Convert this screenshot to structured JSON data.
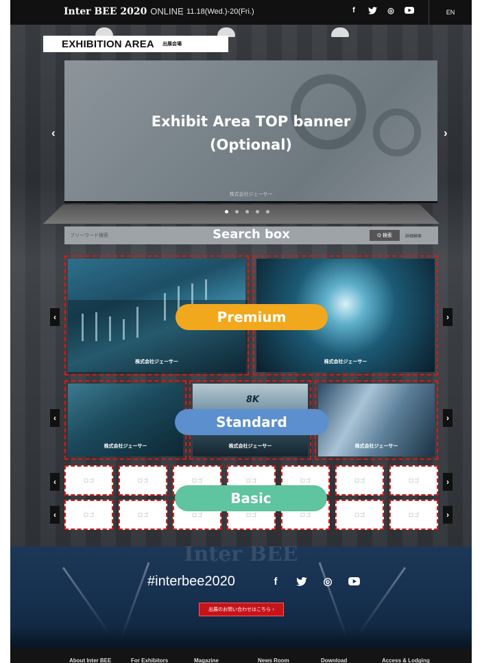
{
  "header": {
    "brand": "Inter BEE 2020",
    "brand_suffix": "ONLINE",
    "dates": "11.18(Wed.)-20(Fri.)",
    "lang": "EN",
    "social": [
      "f",
      "t",
      "◎",
      "▶"
    ]
  },
  "exhibition": {
    "label_en": "EXHIBITION AREA",
    "label_jp": "出展会場"
  },
  "banner": {
    "line1": "Exhibit Area TOP banner",
    "line2": "(Optional)",
    "company": "株式会社ジェーサー",
    "prev": "‹",
    "next": "›"
  },
  "search": {
    "placeholder": "フリーワード検索",
    "title": "Search box",
    "button": "Q 検索",
    "advanced": "詳細検索"
  },
  "premium": {
    "label": "Premium",
    "tiles": [
      "株式会社ジェーサー",
      "株式会社ジェーサー"
    ],
    "prev": "‹",
    "next": "›"
  },
  "standard": {
    "label": "Standard",
    "tiles": [
      "株式会社ジェーサー",
      "株式会社ジェーサー",
      "株式会社ジェーサー"
    ],
    "tile2_badge": "8K",
    "prev": "‹",
    "next": "›"
  },
  "basic": {
    "label": "Basic",
    "row1": [
      "ロゴ",
      "ロゴ",
      "ロゴ",
      "ロゴ",
      "ロゴ",
      "ロゴ",
      "ロゴ"
    ],
    "row2": [
      "ロゴ",
      "ロゴ",
      "ロゴ",
      "ロゴ",
      "ロゴ",
      "ロゴ",
      "ロゴ"
    ],
    "prev": "‹",
    "next": "›"
  },
  "footer": {
    "watermark": "Inter BEE",
    "hashtag": "#interbee2020",
    "social": [
      "f",
      "t",
      "◎",
      "▶"
    ],
    "cta": "出展のお問い合わせはこちら  ›",
    "nav": [
      "About Inter BEE",
      "For Exhibitors",
      "Magazine",
      "News Room",
      "Download",
      "Access & Lodging"
    ]
  },
  "colors": {
    "premium": "#f2a81d",
    "standard": "#5b8fce",
    "basic": "#5fc4a0",
    "dashed_border": "#d41c1c",
    "cta": "#c6141a"
  }
}
